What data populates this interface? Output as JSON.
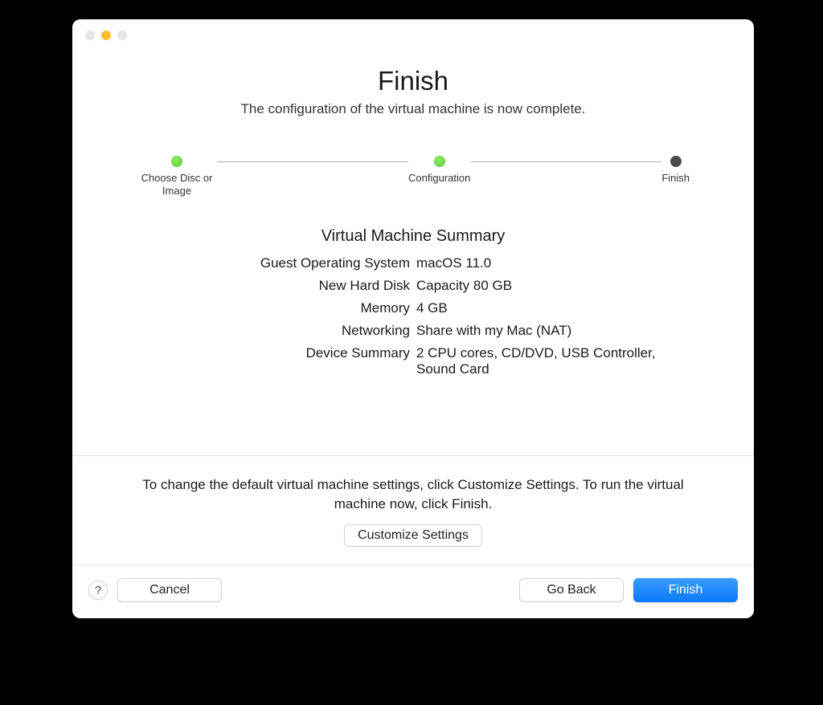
{
  "header": {
    "title": "Finish",
    "subtitle": "The configuration of the virtual machine is now complete."
  },
  "stepper": {
    "steps": [
      {
        "label": "Choose Disc or Image",
        "state": "done"
      },
      {
        "label": "Configuration",
        "state": "done"
      },
      {
        "label": "Finish",
        "state": "current"
      }
    ]
  },
  "summary": {
    "heading": "Virtual Machine Summary",
    "rows": [
      {
        "label": "Guest Operating System",
        "value": "macOS 11.0"
      },
      {
        "label": "New Hard Disk",
        "value": "Capacity 80 GB"
      },
      {
        "label": "Memory",
        "value": "4 GB"
      },
      {
        "label": "Networking",
        "value": "Share with my Mac (NAT)"
      },
      {
        "label": "Device Summary",
        "value": "2 CPU cores, CD/DVD, USB Controller, Sound Card"
      }
    ]
  },
  "lower": {
    "text": "To change the default virtual machine settings, click Customize Settings. To run the virtual machine now, click Finish.",
    "customize_label": "Customize Settings"
  },
  "footer": {
    "help": "?",
    "cancel": "Cancel",
    "goback": "Go Back",
    "finish": "Finish"
  }
}
